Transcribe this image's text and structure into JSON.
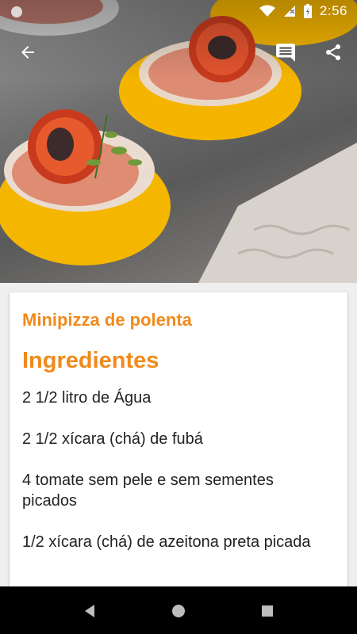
{
  "status_bar": {
    "time": "2:56"
  },
  "toolbar": {
    "back_icon": "arrow-left-icon",
    "comment_icon": "comment-icon",
    "share_icon": "share-icon"
  },
  "recipe": {
    "title": "Minipizza de polenta",
    "section_title": "Ingredientes",
    "ingredients": [
      "2 1/2 litro de Água",
      "2 1/2 xícara (chá) de fubá",
      "4 tomate sem pele e sem sementes picados",
      "1/2 xícara (chá) de azeitona preta picada"
    ]
  },
  "colors": {
    "accent": "#f08a1c",
    "text": "#222222",
    "navbar": "#000000"
  },
  "nav": {
    "back_icon": "triangle-back-icon",
    "home_icon": "circle-home-icon",
    "recents_icon": "square-recents-icon"
  }
}
